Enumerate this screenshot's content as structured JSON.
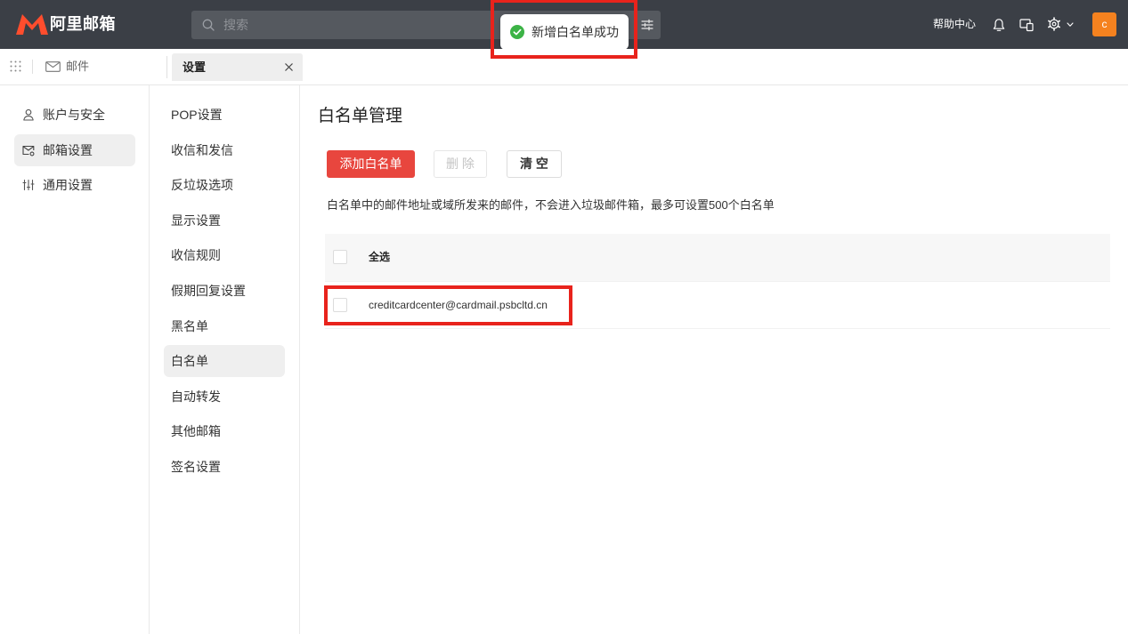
{
  "app": {
    "logo_text": "阿里邮箱",
    "logo_color": "#ff4d2d",
    "header_bg": "#3b3f46"
  },
  "header": {
    "search": {
      "placeholder": "搜索",
      "search_icon": "search-icon",
      "filter_icon": "filter-icon"
    },
    "help_label": "帮助中心",
    "icons": [
      "bell-icon",
      "device-icon",
      "gear-icon",
      "chevron-down-icon"
    ],
    "avatar": {
      "letter": "c",
      "color": "#f5821f"
    }
  },
  "toast": {
    "message": "新增白名单成功",
    "icon": "check-circle-icon",
    "icon_color": "#3cb346"
  },
  "tab_bar": {
    "apps_icon": "grid-icon",
    "mail_icon": "mail-icon",
    "mail_label": "邮件",
    "active_tab": {
      "label": "设置",
      "close_icon": "close-icon"
    }
  },
  "sidebar": {
    "items": [
      {
        "label": "账户与安全",
        "icon": "user-icon",
        "selected": false
      },
      {
        "label": "邮箱设置",
        "icon": "mailbox-settings-icon",
        "selected": true
      },
      {
        "label": "通用设置",
        "icon": "sliders-icon",
        "selected": false
      }
    ]
  },
  "submenu": {
    "items": [
      {
        "label": "POP设置",
        "selected": false
      },
      {
        "label": "收信和发信",
        "selected": false
      },
      {
        "label": "反垃圾选项",
        "selected": false
      },
      {
        "label": "显示设置",
        "selected": false
      },
      {
        "label": "收信规则",
        "selected": false
      },
      {
        "label": "假期回复设置",
        "selected": false
      },
      {
        "label": "黑名单",
        "selected": false
      },
      {
        "label": "白名单",
        "selected": true
      },
      {
        "label": "自动转发",
        "selected": false
      },
      {
        "label": "其他邮箱",
        "selected": false
      },
      {
        "label": "签名设置",
        "selected": false
      }
    ]
  },
  "main": {
    "title": "白名单管理",
    "buttons": {
      "add": {
        "label": "添加白名单",
        "color": "#e8463e"
      },
      "delete": {
        "label": "删 除",
        "disabled": true
      },
      "clear": {
        "label": "清 空"
      }
    },
    "description": "白名单中的邮件地址或域所发来的邮件，不会进入垃圾邮件箱，最多可设置500个白名单",
    "table": {
      "select_all_label": "全选",
      "rows": [
        {
          "address": "creditcardcenter@cardmail.psbcltd.cn",
          "checked": false
        }
      ]
    }
  },
  "annotations": {
    "highlight_color": "#e8231c"
  }
}
